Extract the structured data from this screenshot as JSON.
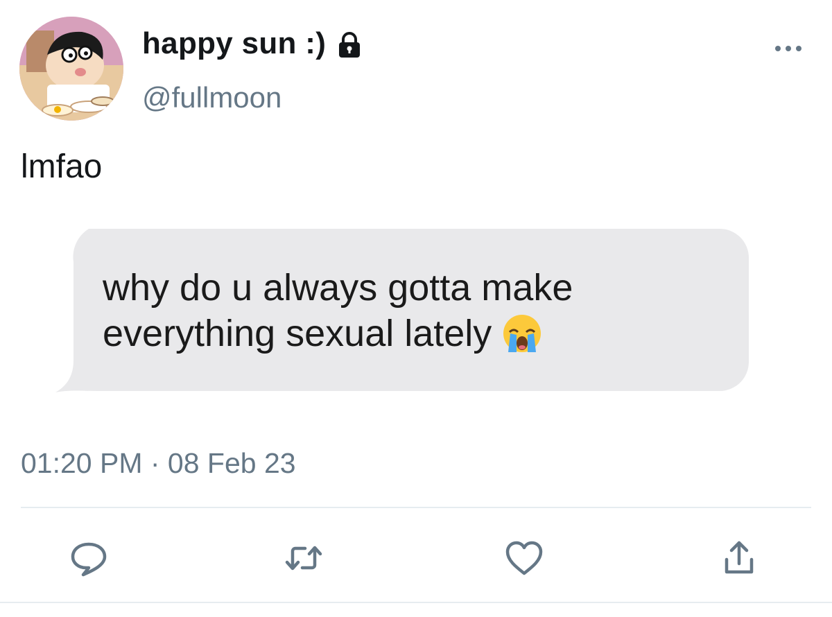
{
  "tweet": {
    "display_name": "happy sun :)",
    "handle": "@fullmoon",
    "text": "lmfao",
    "timestamp": "01:20 PM · 08 Feb 23",
    "protected": true
  },
  "attached_image": {
    "message_text": "why do u always gotta make everything sexual lately"
  },
  "icons": {
    "avatar": "cartoon-avatar",
    "lock": "lock-icon",
    "more": "more-icon",
    "emoji": "loudly-crying-face-icon",
    "reply": "reply-icon",
    "retweet": "retweet-icon",
    "like": "heart-icon",
    "share": "share-icon"
  },
  "colors": {
    "text_primary": "#14171a",
    "text_secondary": "#657786",
    "bubble": "#e9e9eb",
    "divider": "#e6ecf0",
    "action_icon": "#657786"
  }
}
